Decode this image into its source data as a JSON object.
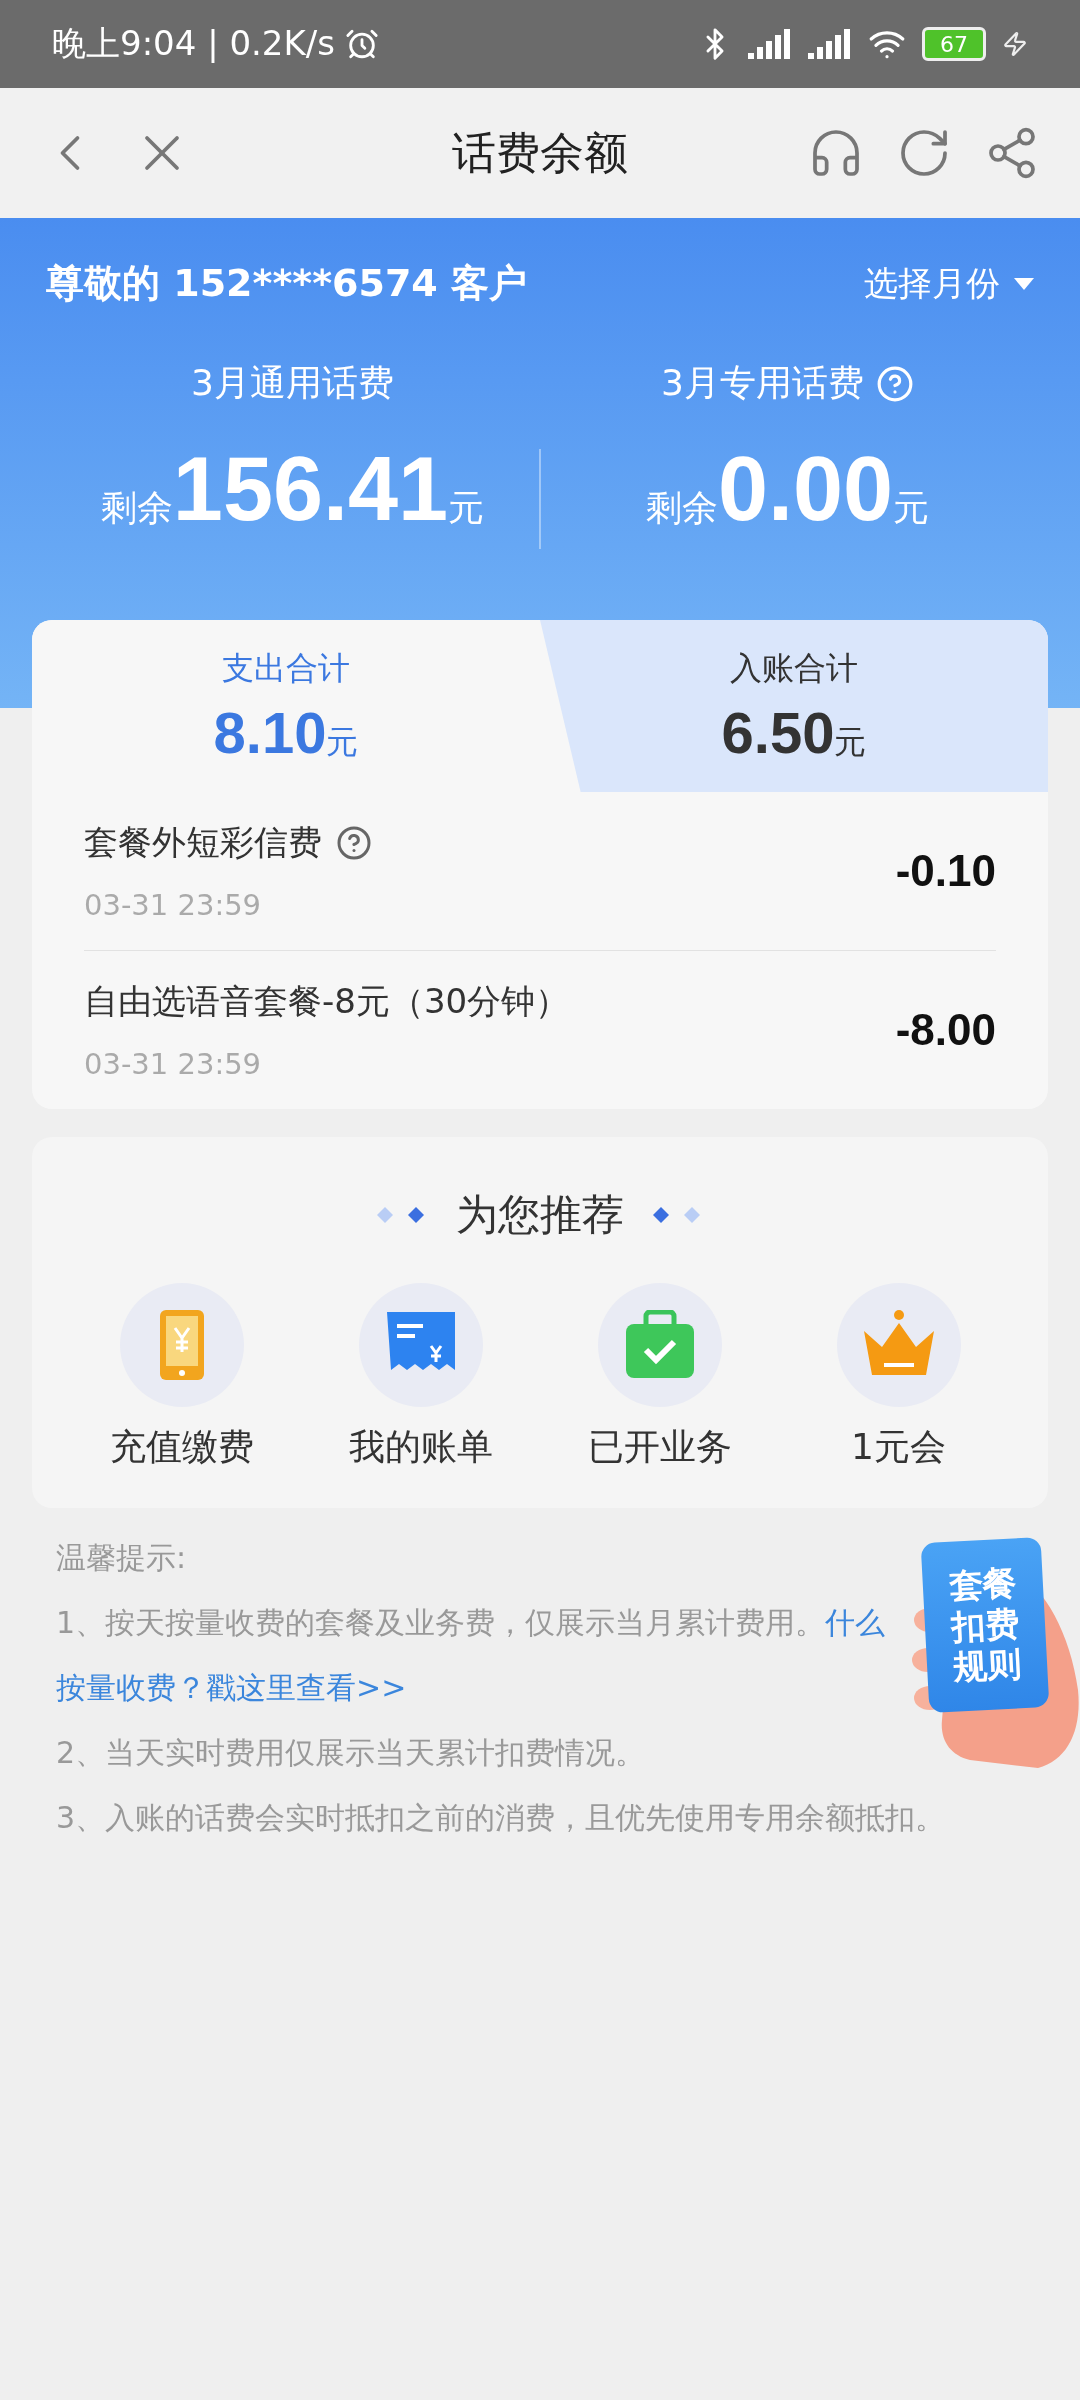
{
  "status_bar": {
    "time": "晚上9:04 | 0.2K/s",
    "battery": "67"
  },
  "header": {
    "title": "话费余额"
  },
  "account": {
    "greeting": "尊敬的 152****6574 客户",
    "month_picker": "选择月份"
  },
  "balances": [
    {
      "label": "3月通用话费",
      "help": false,
      "prefix": "剩余",
      "amount": "156.41",
      "unit": "元"
    },
    {
      "label": "3月专用话费",
      "help": true,
      "prefix": "剩余",
      "amount": "0.00",
      "unit": "元"
    }
  ],
  "summary_tabs": [
    {
      "label": "支出合计",
      "amount": "8.10",
      "unit": "元",
      "selected": true
    },
    {
      "label": "入账合计",
      "amount": "6.50",
      "unit": "元",
      "selected": false
    }
  ],
  "transactions": [
    {
      "name": "套餐外短彩信费",
      "help": true,
      "time": "03-31 23:59",
      "amount": "-0.10"
    },
    {
      "name": "自由选语音套餐-8元（30分钟）",
      "help": false,
      "time": "03-31 23:59",
      "amount": "-8.00"
    }
  ],
  "recommend": {
    "title": "为您推荐",
    "items": [
      {
        "kind": "recharge",
        "label": "充值缴费"
      },
      {
        "kind": "bill",
        "label": "我的账单"
      },
      {
        "kind": "business",
        "label": "已开业务"
      },
      {
        "kind": "vip",
        "label": "1元会"
      }
    ]
  },
  "tips": {
    "title": "温馨提示:",
    "lines": [
      {
        "text": "1、按天按量收费的套餐及业务费，仅展示当月累计费用。",
        "link": "什么"
      },
      {
        "link": "按量收费？戳这里查看>>"
      },
      {
        "text": "2、当天实时费用仅展示当天累计扣费情况。"
      },
      {
        "text": "3、入账的话费会实时抵扣之前的消费，且优先使用专用余额抵扣。"
      }
    ]
  },
  "float_badge": {
    "lines": [
      "套餐",
      "扣费",
      "规则"
    ]
  }
}
